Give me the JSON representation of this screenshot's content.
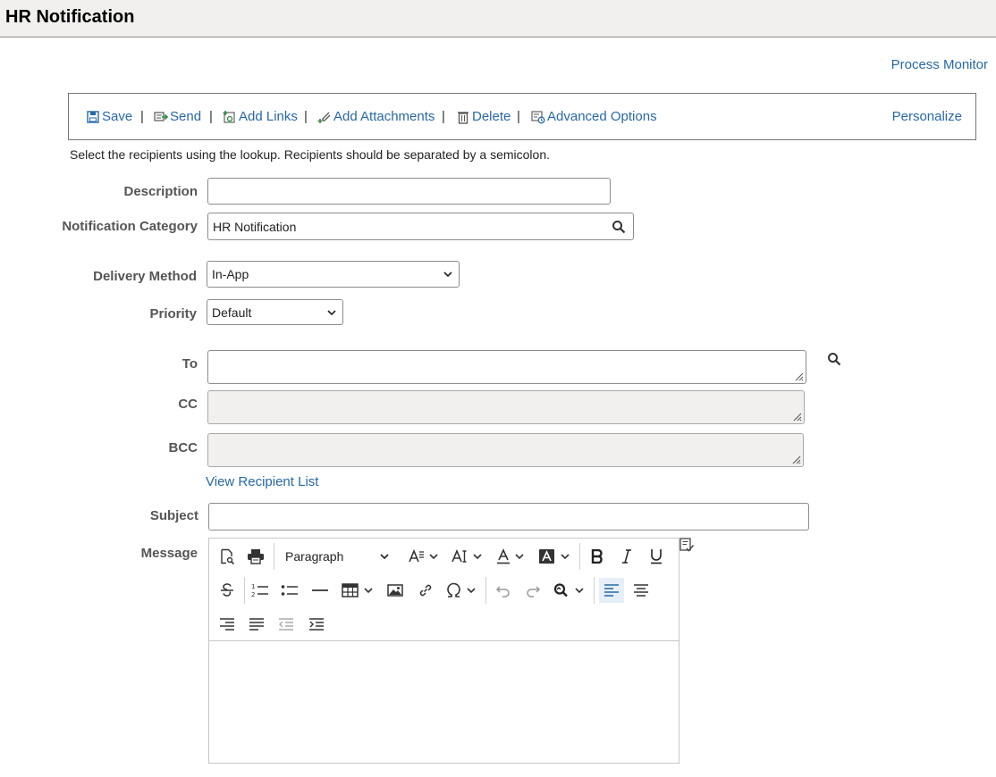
{
  "header": {
    "title": "HR Notification"
  },
  "links": {
    "process_monitor": "Process Monitor",
    "view_recipient_list": "View Recipient List"
  },
  "toolbar": {
    "save": "Save",
    "send": "Send",
    "add_links": "Add Links",
    "add_attachments": "Add Attachments",
    "delete": "Delete",
    "advanced_options": "Advanced Options",
    "personalize": "Personalize",
    "separator": "|"
  },
  "instructions": "Select the recipients using the lookup. Recipients should be separated by a semicolon.",
  "form": {
    "description": {
      "label": "Description",
      "value": ""
    },
    "notification_category": {
      "label": "Notification Category",
      "value": "HR Notification"
    },
    "delivery_method": {
      "label": "Delivery Method",
      "value": "In-App"
    },
    "priority": {
      "label": "Priority",
      "value": "Default"
    },
    "to": {
      "label": "To",
      "value": ""
    },
    "cc": {
      "label": "CC",
      "value": ""
    },
    "bcc": {
      "label": "BCC",
      "value": ""
    },
    "subject": {
      "label": "Subject",
      "value": ""
    },
    "message": {
      "label": "Message",
      "value": ""
    }
  },
  "editor": {
    "format_block": "Paragraph"
  },
  "colors": {
    "link": "#2768a7",
    "header_bg": "#f1f0ef",
    "disabled_bg": "#f1f0ef",
    "active_btn": "#2768a7"
  }
}
